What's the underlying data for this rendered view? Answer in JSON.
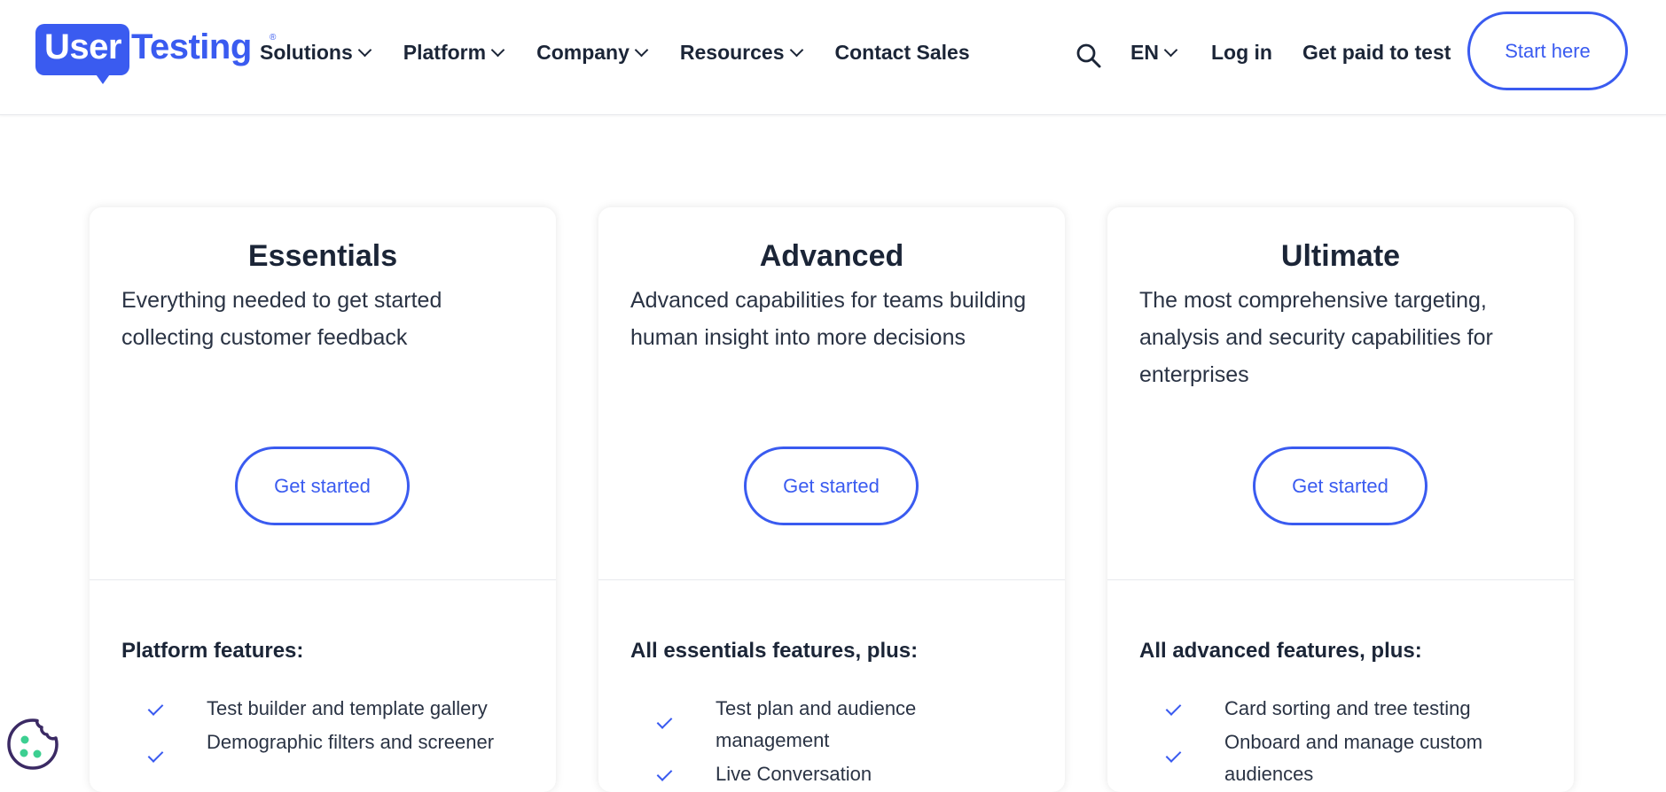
{
  "header": {
    "logo": {
      "part1": "User",
      "part2": "Testing",
      "reg": "®"
    },
    "nav": [
      {
        "label": "Solutions",
        "dropdown": true
      },
      {
        "label": "Platform",
        "dropdown": true
      },
      {
        "label": "Company",
        "dropdown": true
      },
      {
        "label": "Resources",
        "dropdown": true
      },
      {
        "label": "Contact Sales",
        "dropdown": false
      }
    ],
    "language": "EN",
    "login": "Log in",
    "get_paid": "Get paid to test",
    "start_here": "Start here"
  },
  "plans": [
    {
      "title": "Essentials",
      "description": "Everything needed to get started collecting customer feedback",
      "button": "Get started",
      "features_heading": "Platform features:",
      "features": [
        "Test builder and template gallery",
        "Demographic filters and screener"
      ]
    },
    {
      "title": "Advanced",
      "description": "Advanced capabilities for teams building human insight into more decisions",
      "button": "Get started",
      "features_heading": "All essentials features, plus:",
      "features": [
        "Test plan and audience management",
        "Live Conversation"
      ]
    },
    {
      "title": "Ultimate",
      "description": "The most comprehensive targeting, analysis and security capabilities for enterprises",
      "button": "Get started",
      "features_heading": "All advanced features, plus:",
      "features": [
        "Card sorting and tree testing",
        "Onboard and manage custom audiences"
      ]
    }
  ],
  "colors": {
    "brand_blue": "#3a5bf0",
    "text_dark": "#1b2537",
    "cookie_green": "#3ccf91",
    "cookie_outline": "#3b2a64"
  },
  "icons": {
    "search": "search-icon",
    "chevron": "chevron-down-icon",
    "check": "check-icon",
    "cookie": "cookie-icon"
  }
}
